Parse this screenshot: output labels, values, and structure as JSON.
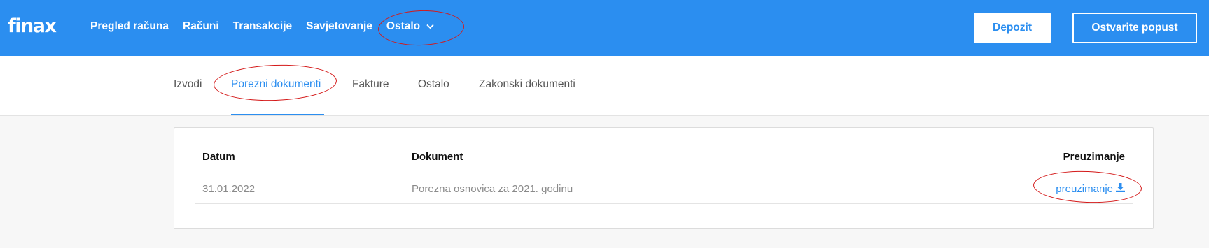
{
  "header": {
    "logo": "finax",
    "nav": [
      {
        "label": "Pregled računa"
      },
      {
        "label": "Računi"
      },
      {
        "label": "Transakcije"
      },
      {
        "label": "Savjetovanje"
      }
    ],
    "more_label": "Ostalo",
    "deposit_label": "Depozit",
    "promo_label": "Ostvarite popust"
  },
  "tabs": [
    {
      "label": "Izvodi"
    },
    {
      "label": "Porezni dokumenti",
      "active": true
    },
    {
      "label": "Fakture"
    },
    {
      "label": "Ostalo"
    },
    {
      "label": "Zakonski dokumenti"
    }
  ],
  "table": {
    "headers": {
      "date": "Datum",
      "document": "Dokument",
      "download": "Preuzimanje"
    },
    "rows": [
      {
        "date": "31.01.2022",
        "document": "Porezna osnovica za 2021. godinu",
        "download": "preuzimanje",
        "download_icon": "download-icon"
      }
    ]
  },
  "colors": {
    "brand": "#2b8ef0",
    "annotation": "#d41919"
  }
}
